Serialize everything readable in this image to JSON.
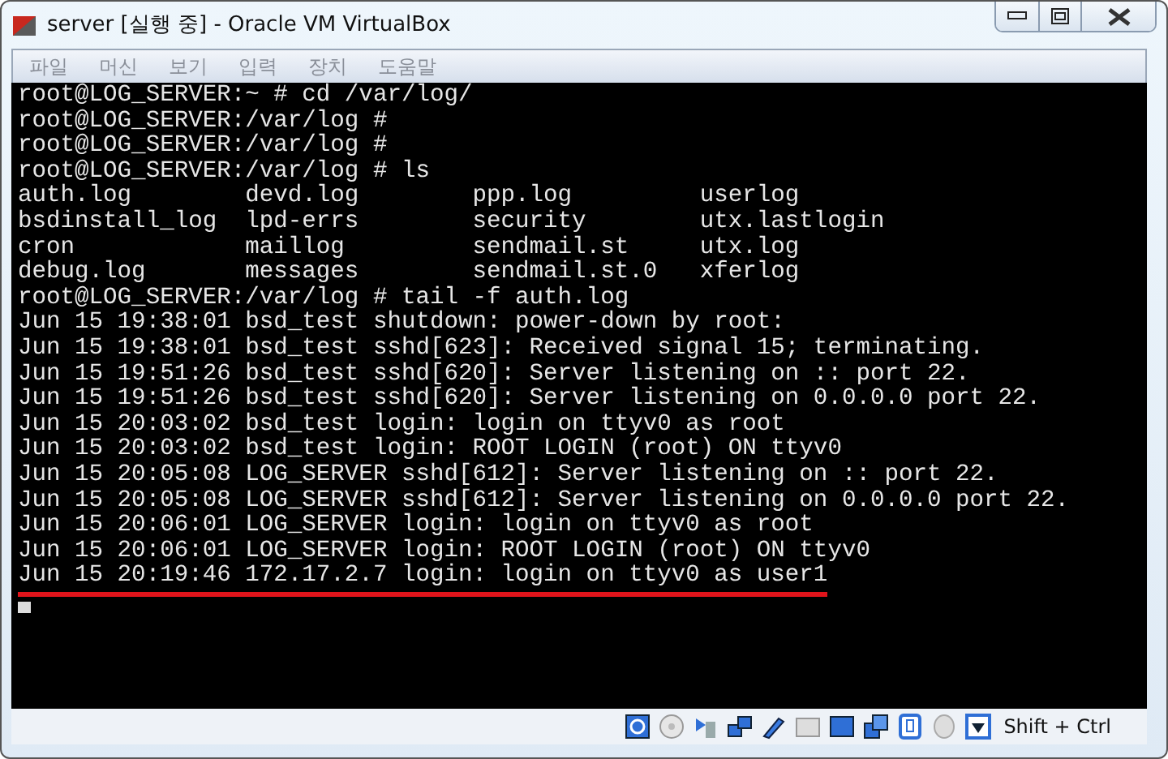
{
  "window": {
    "title": "server [실행 중] - Oracle VM VirtualBox"
  },
  "menu": [
    "파일",
    "머신",
    "보기",
    "입력",
    "장치",
    "도움말"
  ],
  "terminal": {
    "lines": [
      {
        "text": "root@LOG_SERVER:~ # cd /var/log/",
        "underlined": false
      },
      {
        "text": "root@LOG_SERVER:/var/log #",
        "underlined": false
      },
      {
        "text": "root@LOG_SERVER:/var/log #",
        "underlined": false
      },
      {
        "text": "root@LOG_SERVER:/var/log # ls",
        "underlined": false
      },
      {
        "text": "auth.log        devd.log        ppp.log         userlog",
        "underlined": false
      },
      {
        "text": "bsdinstall_log  lpd-errs        security        utx.lastlogin",
        "underlined": false
      },
      {
        "text": "cron            maillog         sendmail.st     utx.log",
        "underlined": false
      },
      {
        "text": "debug.log       messages        sendmail.st.0   xferlog",
        "underlined": false
      },
      {
        "text": "root@LOG_SERVER:/var/log # tail -f auth.log",
        "underlined": false
      },
      {
        "text": "Jun 15 19:38:01 bsd_test shutdown: power-down by root:",
        "underlined": false
      },
      {
        "text": "Jun 15 19:38:01 bsd_test sshd[623]: Received signal 15; terminating.",
        "underlined": false
      },
      {
        "text": "Jun 15 19:51:26 bsd_test sshd[620]: Server listening on :: port 22.",
        "underlined": false
      },
      {
        "text": "Jun 15 19:51:26 bsd_test sshd[620]: Server listening on 0.0.0.0 port 22.",
        "underlined": false
      },
      {
        "text": "Jun 15 20:03:02 bsd_test login: login on ttyv0 as root",
        "underlined": false
      },
      {
        "text": "Jun 15 20:03:02 bsd_test login: ROOT LOGIN (root) ON ttyv0",
        "underlined": false
      },
      {
        "text": "Jun 15 20:05:08 LOG_SERVER sshd[612]: Server listening on :: port 22.",
        "underlined": false
      },
      {
        "text": "Jun 15 20:05:08 LOG_SERVER sshd[612]: Server listening on 0.0.0.0 port 22.",
        "underlined": false
      },
      {
        "text": "Jun 15 20:06:01 LOG_SERVER login: login on ttyv0 as root",
        "underlined": false
      },
      {
        "text": "Jun 15 20:06:01 LOG_SERVER login: ROOT LOGIN (root) ON ttyv0",
        "underlined": false
      },
      {
        "text": "Jun 15 20:19:46 172.17.2.7 login: login on ttyv0 as user1",
        "underlined": true
      }
    ]
  },
  "status_bar": {
    "host_key": "Shift + Ctrl"
  }
}
